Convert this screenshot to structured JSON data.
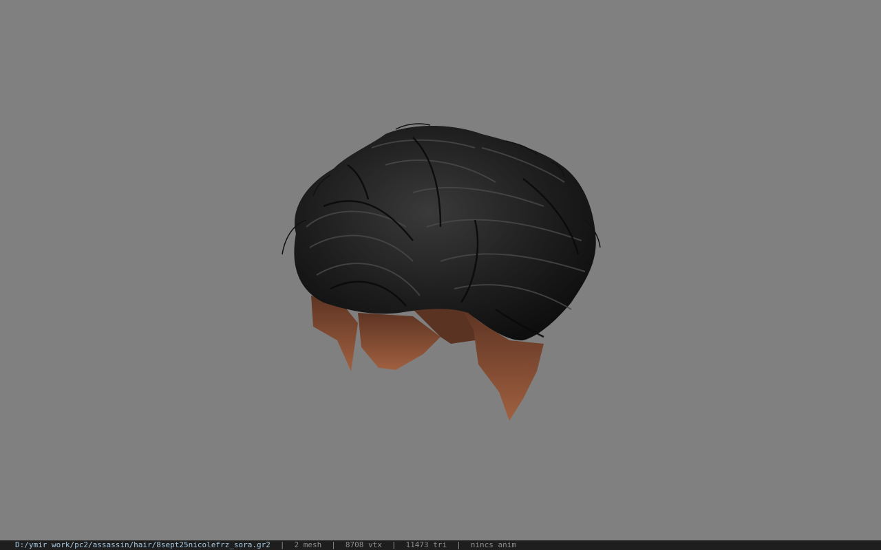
{
  "viewport": {
    "background_color": "#808080",
    "model": "hair-mesh",
    "hair_color": "#1a1a1a",
    "skin_color": "#7a4a35"
  },
  "statusbar": {
    "file_path": "D:/ymir work/pc2/assassin/hair/8sept25nicolefrz_sora.gr2",
    "separator": "|",
    "mesh_count": "2 mesh",
    "vertex_count": "8708 vtx",
    "triangle_count": "11473 tri",
    "anim_status": "nincs anim"
  }
}
